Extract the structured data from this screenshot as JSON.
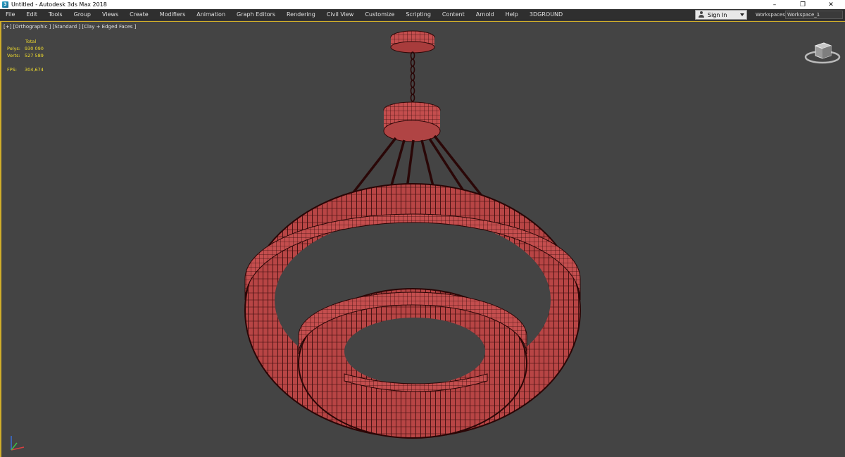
{
  "window": {
    "title": "Untitled - Autodesk 3ds Max 2018",
    "minimize": "–",
    "maximize": "❐",
    "close": "✕"
  },
  "menu": [
    "File",
    "Edit",
    "Tools",
    "Group",
    "Views",
    "Create",
    "Modifiers",
    "Animation",
    "Graph Editors",
    "Rendering",
    "Civil View",
    "Customize",
    "Scripting",
    "Content",
    "Arnold",
    "Help",
    "3DGROUND"
  ],
  "signin": {
    "label": "Sign In"
  },
  "workspace": {
    "label": "Workspaces:",
    "value": "Workspace_1"
  },
  "viewport": {
    "label": "[+] [Orthographic ] [Standard ] [Clay + Edged Faces ]",
    "stats": {
      "header": "Total",
      "polys_label": "Polys:",
      "polys_value": "930 090",
      "verts_label": "Verts:",
      "verts_value": "527 589",
      "fps_label": "FPS:",
      "fps_value": "304,674"
    }
  },
  "colors": {
    "viewport_bg": "#444444",
    "active_border": "#d1ae2a",
    "stats_text": "#f4df2c",
    "model_fill": "#c24a4a",
    "model_edges": "#3a0d0d"
  }
}
